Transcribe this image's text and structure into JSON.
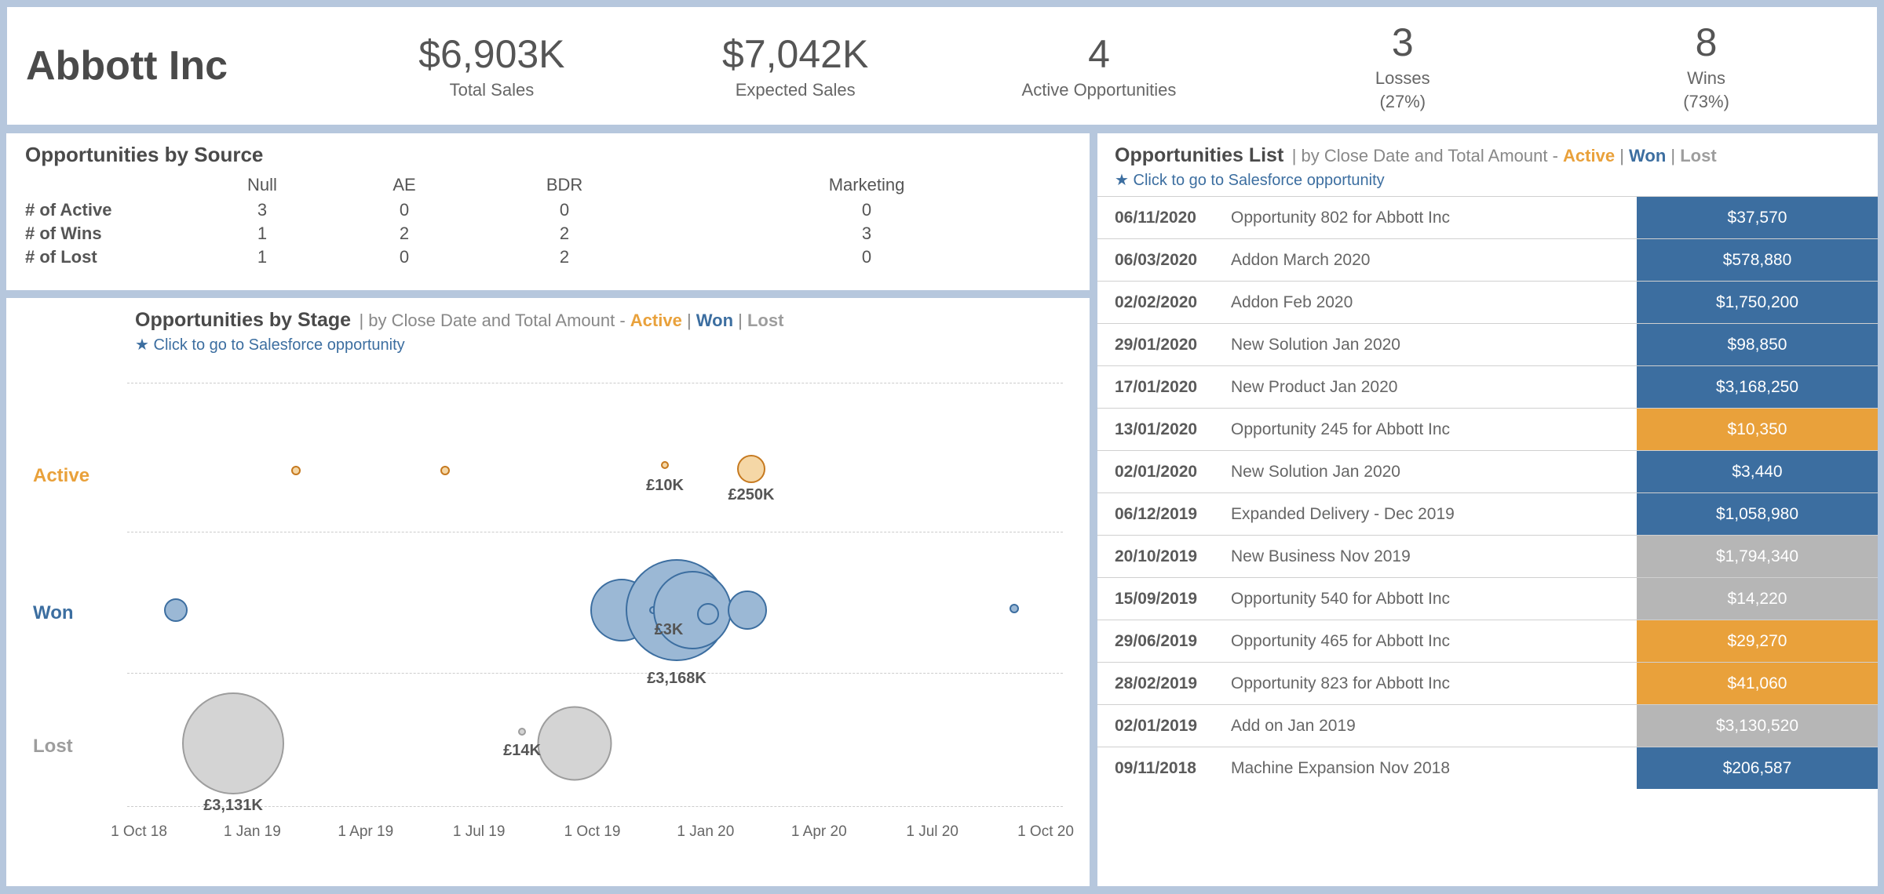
{
  "company_name": "Abbott Inc",
  "kpis": {
    "total_sales": {
      "value": "$6,903K",
      "label": "Total Sales"
    },
    "expected_sales": {
      "value": "$7,042K",
      "label": "Expected Sales"
    },
    "active_opps": {
      "value": "4",
      "label": "Active Opportunities"
    },
    "losses": {
      "value": "3",
      "label": "Losses",
      "sub": "(27%)"
    },
    "wins": {
      "value": "8",
      "label": "Wins",
      "sub": "(73%)"
    }
  },
  "source_table": {
    "title": "Opportunities by Source",
    "columns": [
      "Null",
      "AE",
      "BDR",
      "Marketing"
    ],
    "row_labels": [
      "# of Active",
      "# of Wins",
      "# of Lost"
    ],
    "rows": [
      [
        3,
        0,
        0,
        0
      ],
      [
        1,
        2,
        2,
        3
      ],
      [
        1,
        0,
        2,
        0
      ]
    ]
  },
  "stage_chart": {
    "title": "Opportunities by Stage",
    "subtitle": "| by Close Date and Total Amount  -",
    "legend": {
      "active": "Active",
      "won": "Won",
      "lost": "Lost",
      "sep": " | "
    },
    "hint": "Click to go to Salesforce opportunity",
    "row_labels": {
      "active": "Active",
      "won": "Won",
      "lost": "Lost"
    },
    "annotations": {
      "a1": "£10K",
      "a2": "£250K",
      "w1": "£3K",
      "w2": "£3,168K",
      "l1": "£14K",
      "l2": "£3,131K"
    },
    "x_ticks": [
      "1 Oct 18",
      "1 Jan 19",
      "1 Apr 19",
      "1 Jul 19",
      "1 Oct 19",
      "1 Jan 20",
      "1 Apr 20",
      "1 Jul 20",
      "1 Oct 20"
    ]
  },
  "opp_list": {
    "title": "Opportunities List",
    "subtitle": "| by Close Date and Total Amount  -",
    "hint": "Click to go to Salesforce opportunity",
    "legend": {
      "active": "Active",
      "won": "Won",
      "lost": "Lost",
      "sep": " | "
    },
    "rows": [
      {
        "date": "06/11/2020",
        "name": "Opportunity 802 for Abbott Inc",
        "amount": "$37,570",
        "status": "won"
      },
      {
        "date": "06/03/2020",
        "name": "Addon March 2020",
        "amount": "$578,880",
        "status": "won"
      },
      {
        "date": "02/02/2020",
        "name": "Addon Feb 2020",
        "amount": "$1,750,200",
        "status": "won"
      },
      {
        "date": "29/01/2020",
        "name": "New Solution Jan 2020",
        "amount": "$98,850",
        "status": "won"
      },
      {
        "date": "17/01/2020",
        "name": "New Product Jan 2020",
        "amount": "$3,168,250",
        "status": "won"
      },
      {
        "date": "13/01/2020",
        "name": "Opportunity 245 for Abbott Inc",
        "amount": "$10,350",
        "status": "active"
      },
      {
        "date": "02/01/2020",
        "name": "New Solution Jan 2020",
        "amount": "$3,440",
        "status": "won"
      },
      {
        "date": "06/12/2019",
        "name": "Expanded Delivery - Dec 2019",
        "amount": "$1,058,980",
        "status": "won"
      },
      {
        "date": "20/10/2019",
        "name": "New Business Nov 2019",
        "amount": "$1,794,340",
        "status": "lost"
      },
      {
        "date": "15/09/2019",
        "name": "Opportunity 540 for Abbott Inc",
        "amount": "$14,220",
        "status": "lost"
      },
      {
        "date": "29/06/2019",
        "name": "Opportunity 465 for Abbott Inc",
        "amount": "$29,270",
        "status": "active"
      },
      {
        "date": "28/02/2019",
        "name": "Opportunity 823 for Abbott Inc",
        "amount": "$41,060",
        "status": "active"
      },
      {
        "date": "02/01/2019",
        "name": "Add on Jan 2019",
        "amount": "$3,130,520",
        "status": "lost"
      },
      {
        "date": "09/11/2018",
        "name": "Machine Expansion Nov 2018",
        "amount": "$206,587",
        "status": "won"
      }
    ]
  },
  "chart_data": {
    "type": "bubble",
    "title": "Opportunities by Stage",
    "x_axis": "Close Date",
    "y_axis": "Stage (categorical)",
    "size_encodes": "Total Amount (£)",
    "x_ticks": [
      "1 Oct 18",
      "1 Jan 19",
      "1 Apr 19",
      "1 Jul 19",
      "1 Oct 19",
      "1 Jan 20",
      "1 Apr 20",
      "1 Jul 20",
      "1 Oct 20"
    ],
    "series": [
      {
        "name": "Active",
        "color": "#e9a13b",
        "points": [
          {
            "x": "28/02/2019",
            "amount_gbp": 41000
          },
          {
            "x": "29/06/2019",
            "amount_gbp": 29000
          },
          {
            "x": "13/01/2020",
            "amount_gbp": 10000,
            "label": "£10K"
          },
          {
            "x": "01/04/2020",
            "amount_gbp": 250000,
            "label": "£250K"
          }
        ]
      },
      {
        "name": "Won",
        "color": "#3c6ea0",
        "points": [
          {
            "x": "09/11/2018",
            "amount_gbp": 206000
          },
          {
            "x": "06/12/2019",
            "amount_gbp": 1059000
          },
          {
            "x": "02/01/2020",
            "amount_gbp": 3000,
            "label": "£3K"
          },
          {
            "x": "17/01/2020",
            "amount_gbp": 3168000,
            "label": "£3,168K"
          },
          {
            "x": "29/01/2020",
            "amount_gbp": 99000
          },
          {
            "x": "02/02/2020",
            "amount_gbp": 1750000
          },
          {
            "x": "06/03/2020",
            "amount_gbp": 579000
          },
          {
            "x": "06/11/2020",
            "amount_gbp": 38000
          }
        ]
      },
      {
        "name": "Lost",
        "color": "#9d9d9d",
        "points": [
          {
            "x": "02/01/2019",
            "amount_gbp": 3131000,
            "label": "£3,131K"
          },
          {
            "x": "15/09/2019",
            "amount_gbp": 14000,
            "label": "£14K"
          },
          {
            "x": "20/10/2019",
            "amount_gbp": 1794000
          }
        ]
      }
    ]
  }
}
